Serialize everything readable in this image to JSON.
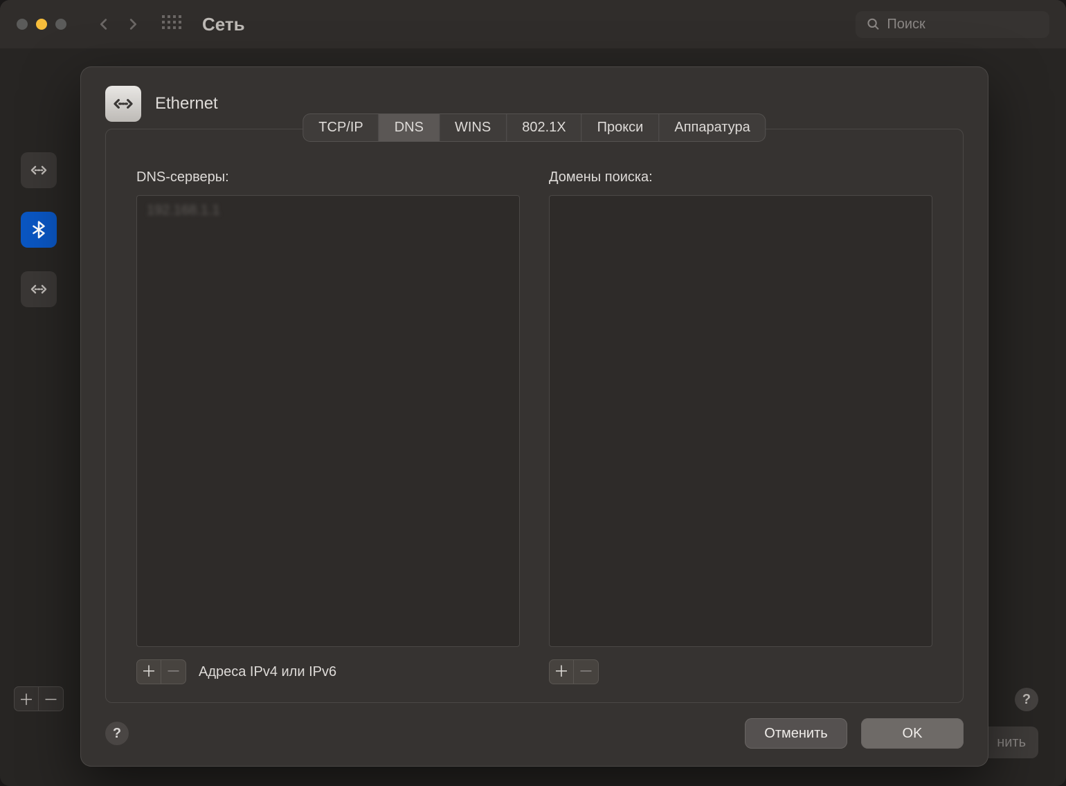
{
  "window": {
    "title": "Сеть",
    "search_placeholder": "Поиск"
  },
  "background": {
    "apply_button": "нить"
  },
  "sheet": {
    "interface_name": "Ethernet",
    "tabs": {
      "tcpip": "TCP/IP",
      "dns": "DNS",
      "wins": "WINS",
      "dot1x": "802.1X",
      "proxy": "Прокси",
      "hardware": "Аппаратура"
    },
    "active_tab": "dns",
    "dns": {
      "servers_label": "DNS-серверы:",
      "domains_label": "Домены поиска:",
      "servers": [
        "192.168.1.1"
      ],
      "domains": [],
      "servers_hint": "Адреса IPv4 или IPv6"
    },
    "buttons": {
      "cancel": "Отменить",
      "ok": "OK"
    }
  }
}
